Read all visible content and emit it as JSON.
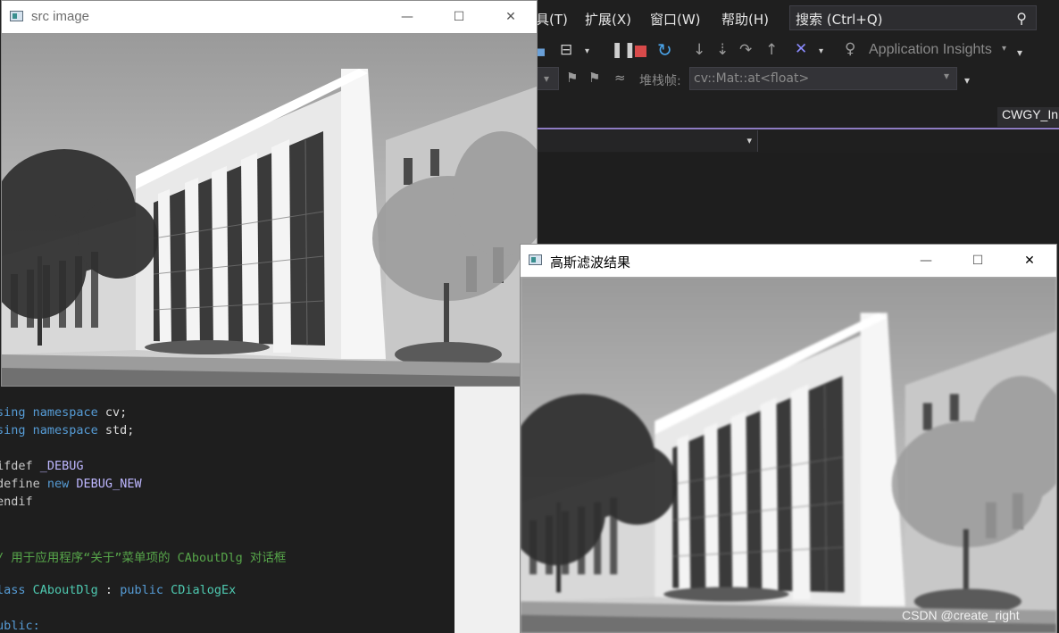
{
  "vs": {
    "menu": [
      {
        "label": "具(T)"
      },
      {
        "label": "扩展(X)"
      },
      {
        "label": "窗口(W)"
      },
      {
        "label": "帮助(H)"
      }
    ],
    "search_label": "搜索 (Ctrl+Q)",
    "app_insights_label": "Application Insights",
    "stack_frame_label": "堆栈帧:",
    "stack_frame_value": "cv::Mat::at<float>",
    "doc_tab_label": "CWGY_In",
    "stop_color": "#d84a4a",
    "accent_color": "#8e7cc3"
  },
  "editor": {
    "lines": [
      {
        "id": "l1",
        "parts": [
          "sing",
          " namespace",
          " cv;"
        ]
      },
      {
        "id": "l2",
        "parts": [
          "sing",
          " namespace",
          " std;"
        ]
      },
      {
        "id": "l3",
        "parts": [
          "ifdef",
          " _DEBUG"
        ]
      },
      {
        "id": "l4",
        "parts": [
          "define",
          " new",
          " DEBUG_NEW"
        ]
      },
      {
        "id": "l5",
        "parts": [
          "endif"
        ]
      },
      {
        "id": "l6",
        "parts": [
          "/ 用于应用程序“关于”菜单项的 CAboutDlg 对话框"
        ]
      },
      {
        "id": "l7",
        "parts": [
          "lass",
          " CAboutDlg",
          " : ",
          "public",
          " CDialogEx"
        ]
      },
      {
        "id": "l8",
        "parts": [
          "ublic:"
        ]
      }
    ]
  },
  "windows": {
    "src": {
      "title": "src image"
    },
    "blur": {
      "title": "高斯滤波结果"
    },
    "min_icon": "—",
    "max_icon": "☐",
    "close_icon": "✕"
  },
  "watermark": "CSDN @create_right"
}
